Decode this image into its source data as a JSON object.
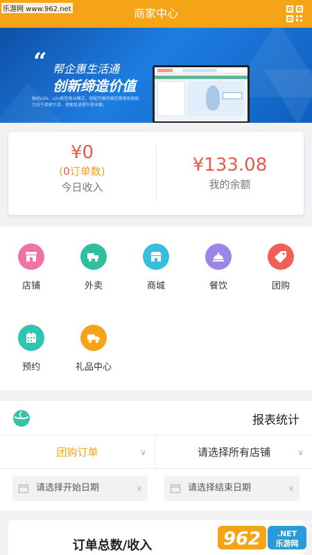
{
  "watermark": {
    "site": "乐游网 www.962.net"
  },
  "header": {
    "title": "商家中心",
    "right_icon": "qrcode-icon"
  },
  "banner": {
    "slogan_line1": "帮企惠生活通",
    "slogan_line2": "创新缔造价值",
    "description": "独创o2b、o2o新型商业模式，搭配完善的微信营销系统助力万千商家引流、锁客促进提升营业额。",
    "slide_count": 4,
    "active_slide": 1
  },
  "stats": {
    "today_amount": "¥0",
    "order_prefix": "(",
    "order_num": "0",
    "order_suffix": "订单数)",
    "today_label": "今日收入",
    "balance_amount": "¥133.08",
    "balance_label": "我的余额"
  },
  "modules": [
    {
      "label": "店铺",
      "icon": "store-icon",
      "color": "#f072a6"
    },
    {
      "label": "外卖",
      "icon": "delivery-icon",
      "color": "#2fbf9f"
    },
    {
      "label": "商城",
      "icon": "mall-icon",
      "color": "#38bde0"
    },
    {
      "label": "餐饮",
      "icon": "dining-icon",
      "color": "#9b86e6"
    },
    {
      "label": "团购",
      "icon": "tag-icon",
      "color": "#f06056"
    },
    {
      "label": "预约",
      "icon": "calendar-icon",
      "color": "#31c4b4"
    },
    {
      "label": "礼品中心",
      "icon": "truck-icon",
      "color": "#f5a317"
    }
  ],
  "report": {
    "title": "报表统计",
    "order_type": "团购订单",
    "store_select": "请选择所有店铺",
    "start_date_placeholder": "请选择开始日期",
    "end_date_placeholder": "请选择结束日期",
    "summary_title": "订单总数/收入"
  },
  "footer_watermark": {
    "brand": "962",
    "suffix": ".NET",
    "sub": "乐游网"
  },
  "colors": {
    "primary": "#f5a317",
    "accent_red": "#e8574e",
    "teal": "#39c3a6"
  }
}
